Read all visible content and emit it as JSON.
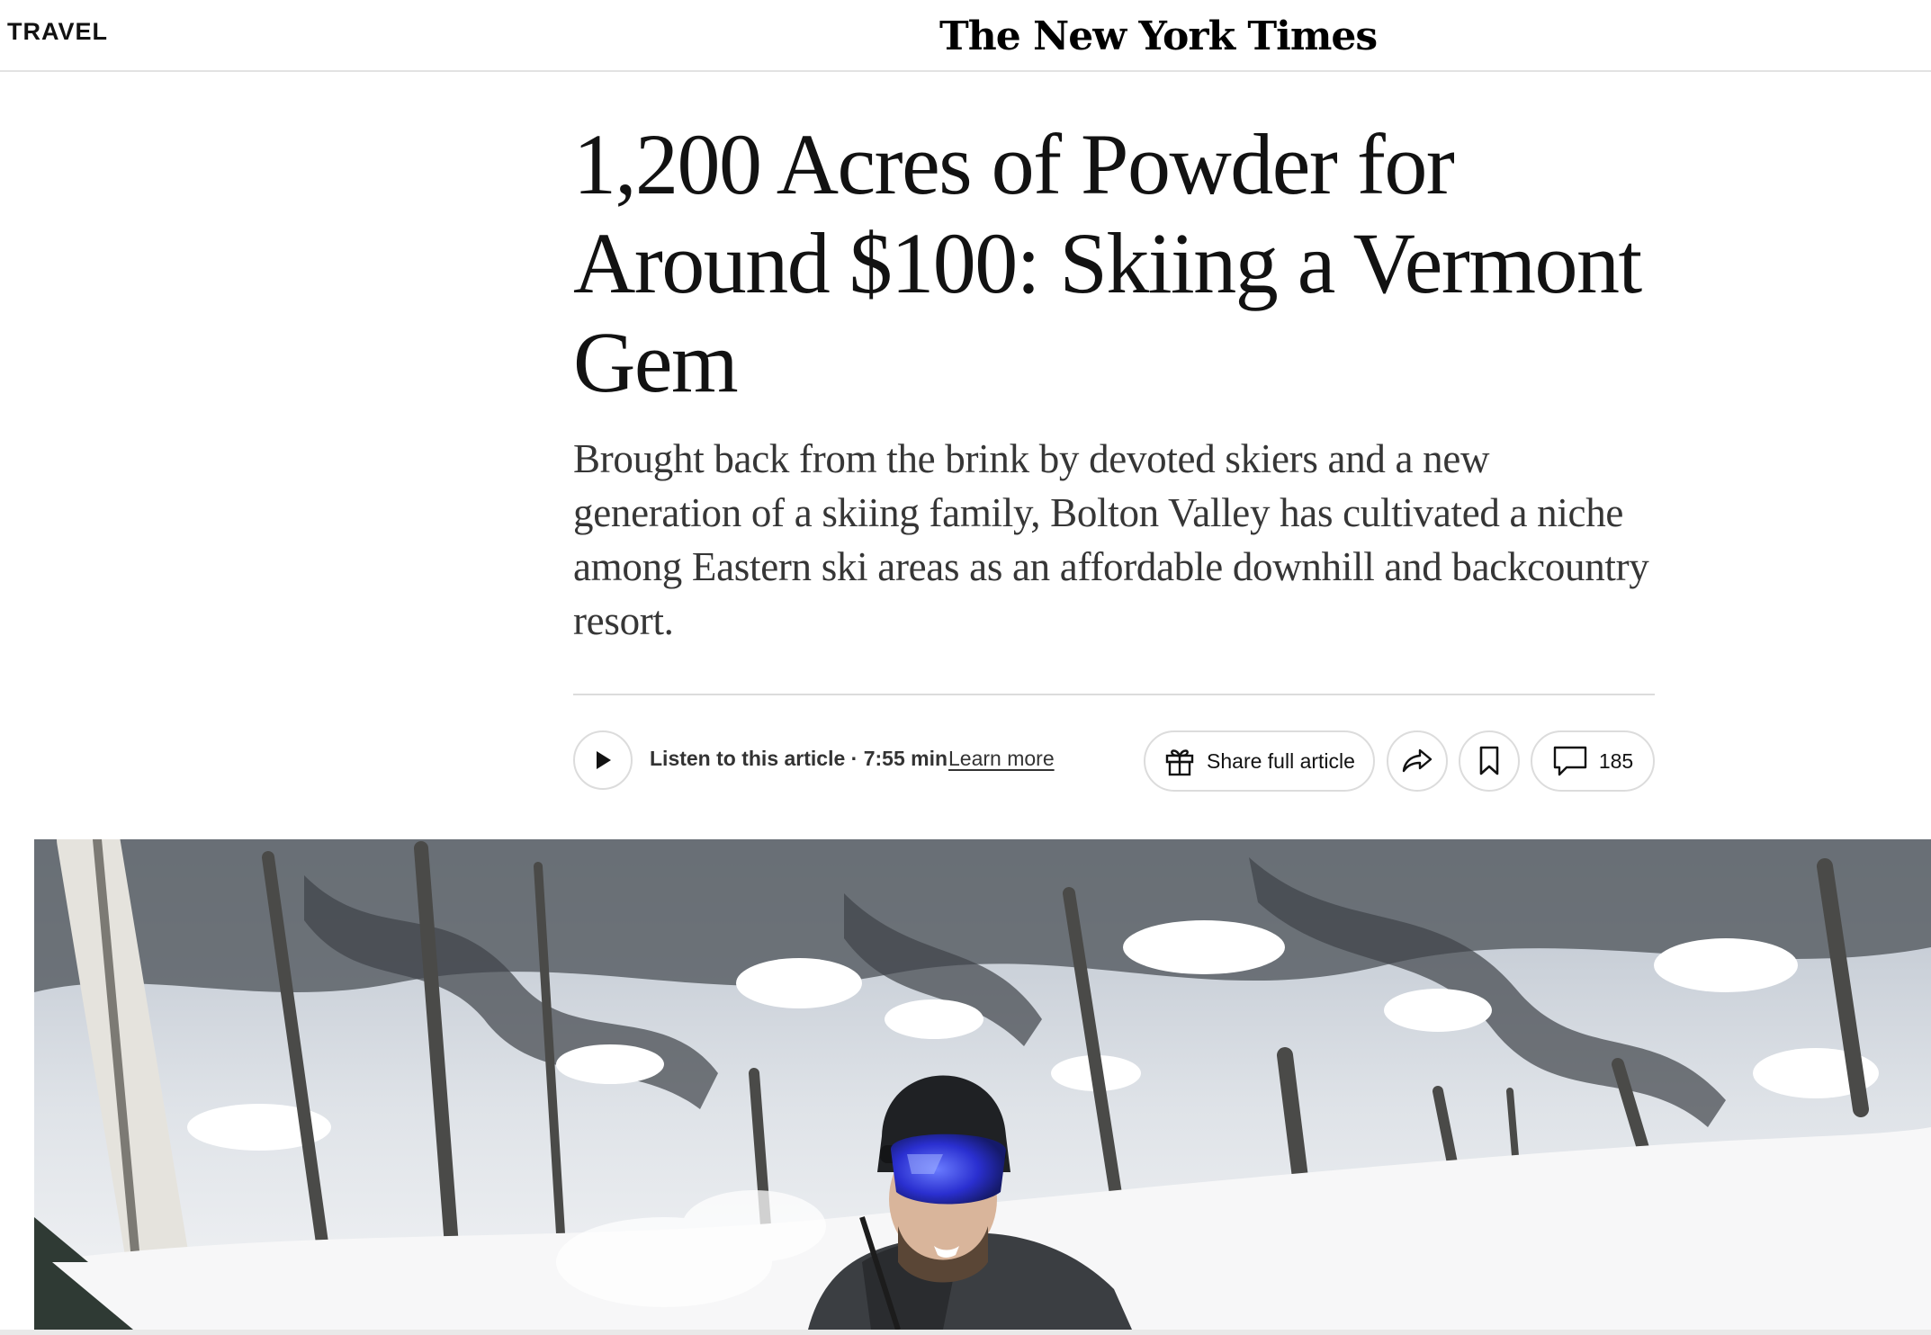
{
  "header": {
    "section": "TRAVEL",
    "masthead": "The New York Times"
  },
  "article": {
    "headline": "1,200 Acres of Powder for Around $100: Skiing a Vermont Gem",
    "summary": "Brought back from the brink by devoted skiers and a new generation of a skiing family, Bolton Valley has cultivated a niche among Eastern ski areas as an affordable downhill and backcountry resort."
  },
  "actions": {
    "play_icon": "play-icon",
    "listen_label": "Listen to this article · 7:55 min",
    "learn_more": "Learn more",
    "share_label": "Share full article",
    "share_icon": "gift-icon",
    "forward_icon": "share-arrow-icon",
    "save_icon": "bookmark-icon",
    "comments_icon": "comment-icon",
    "comments_count": "185"
  },
  "hero": {
    "image": "skier-in-snowy-forest"
  }
}
